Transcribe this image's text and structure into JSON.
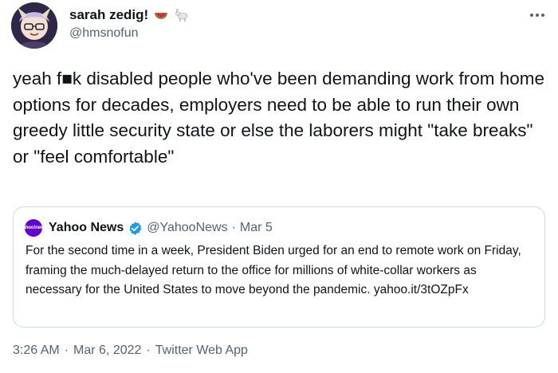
{
  "author": {
    "display_name": "sarah zedig!",
    "handle": "@hmsnofun",
    "name_emojis": [
      "watermelon-emoji",
      "goat-emoji"
    ]
  },
  "tweet": {
    "text": "yeah f■k disabled people who've been demanding work from home options for decades, employers need to be able to run their own greedy little security state or else the laborers might \"take breaks\" or \"feel comfortable\""
  },
  "quoted_tweet": {
    "avatar_text": "yahoo!news",
    "display_name": "Yahoo News",
    "verified": true,
    "handle": "@YahooNews",
    "separator": "·",
    "date": "Mar 5",
    "text": "For the second time in a week, President Biden urged for an end to remote work on Friday, framing the much-delayed return to the office for millions of white-collar workers as necessary for the United States to move beyond the pandemic. yahoo.it/3tOZpFx"
  },
  "footer": {
    "time": "3:26 AM",
    "separator1": "·",
    "date": "Mar 6, 2022",
    "separator2": "·",
    "source": "Twitter Web App"
  },
  "colors": {
    "text_primary": "#0f1419",
    "text_secondary": "#536471",
    "border": "#cfd9de",
    "verified_blue": "#1d9bf0",
    "yahoo_purple": "#6001d2"
  }
}
